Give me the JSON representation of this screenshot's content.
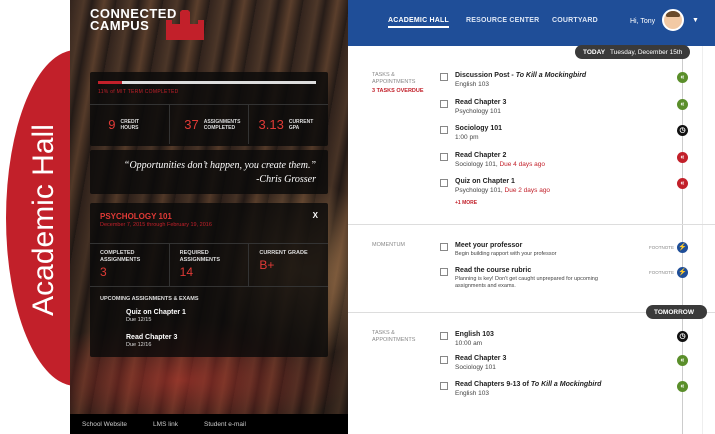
{
  "side_tab": {
    "label": "Academic Hall"
  },
  "logo": {
    "line1": "CONNECTED",
    "line2": "CAMPUS"
  },
  "progress": {
    "fraction": 0.11,
    "text": "11% of MIT TERM COMPLETED"
  },
  "stats": [
    {
      "value": "9",
      "label": "CREDIT HOURS"
    },
    {
      "value": "37",
      "label": "ASSIGNMENTS COMPLETED"
    },
    {
      "value": "3.13",
      "label": "CURRENT GPA"
    }
  ],
  "quote": {
    "text": "“Opportunities don’t happen, you create them.”",
    "author": "-Chris Grosser"
  },
  "course": {
    "title": "PSYCHOLOGY 101",
    "dates": "December 7, 2015 through February 19, 2016",
    "close": "X",
    "stats": [
      {
        "label": "COMPLETED ASSIGNMENTS",
        "value": "3"
      },
      {
        "label": "REQUIRED ASSIGNMENTS",
        "value": "14"
      },
      {
        "label": "CURRENT GRADE",
        "value": "B+"
      }
    ],
    "upcoming_title": "UPCOMING ASSIGNMENTS & EXAMS",
    "upcoming": [
      {
        "title": "Quiz on Chapter 1",
        "due": "Due 12/15"
      },
      {
        "title": "Read Chapter 3",
        "due": "Due 12/16"
      }
    ]
  },
  "footer": {
    "links": [
      "School Website",
      "LMS link",
      "Student e-mail"
    ]
  },
  "nav": {
    "tabs": [
      "ACADEMIC HALL",
      "RESOURCE CENTER",
      "COURTYARD"
    ],
    "greeting": "Hi, Tony",
    "caret": "▼"
  },
  "today": {
    "label": "TODAY",
    "date": "Tuesday, December 15th"
  },
  "tomorrow": {
    "label": "TOMORROW"
  },
  "sections": {
    "tasks1_label": "TASKS & APPOINTMENTS",
    "tasks1_overdue": "3 TASKS OVERDUE",
    "momentum_label": "MOMENTUM",
    "tasks2_label": "TASKS & APPOINTMENTS",
    "more": "+1 MORE",
    "footnote": "FOOTNOTE"
  },
  "today_tasks": [
    {
      "title_pre": "Discussion Post - ",
      "title_em": "To Kill a Mockingbird",
      "sub": "English 103",
      "due": "",
      "dot": "green",
      "icon": "«"
    },
    {
      "title_pre": "Read Chapter 3",
      "title_em": "",
      "sub": "Psychology 101",
      "due": "",
      "dot": "green",
      "icon": "«"
    },
    {
      "title_pre": "Sociology 101",
      "title_em": "",
      "sub": "1:00 pm",
      "due": "",
      "dot": "black",
      "icon": "◷"
    },
    {
      "title_pre": "Read Chapter 2",
      "title_em": "",
      "sub": "Sociology 101, ",
      "due": "Due 4 days ago",
      "dot": "red",
      "icon": "«"
    },
    {
      "title_pre": "Quiz on Chapter 1",
      "title_em": "",
      "sub": "Psychology 101, ",
      "due": "Due 2 days ago",
      "dot": "red",
      "icon": "«"
    }
  ],
  "momentum_tasks": [
    {
      "title": "Meet your professor",
      "sub": "Begin building rapport with your professor",
      "sub2": "",
      "icon": "⚡"
    },
    {
      "title": "Read the course rubric",
      "sub": "Planning is key! Don't get caught unprepared for upcoming",
      "sub2": "assignments and exams.",
      "icon": "⚡"
    }
  ],
  "tomorrow_tasks": [
    {
      "title_pre": "English 103",
      "title_em": "",
      "sub": "10:00 am",
      "dot": "black",
      "icon": "◷"
    },
    {
      "title_pre": "Read Chapter 3",
      "title_em": "",
      "sub": "Sociology 101",
      "dot": "green",
      "icon": "«"
    },
    {
      "title_pre": "Read Chapters 9-13 of ",
      "title_em": "To Kill a Mockingbird",
      "sub": "English 103",
      "dot": "green",
      "icon": "«"
    }
  ]
}
